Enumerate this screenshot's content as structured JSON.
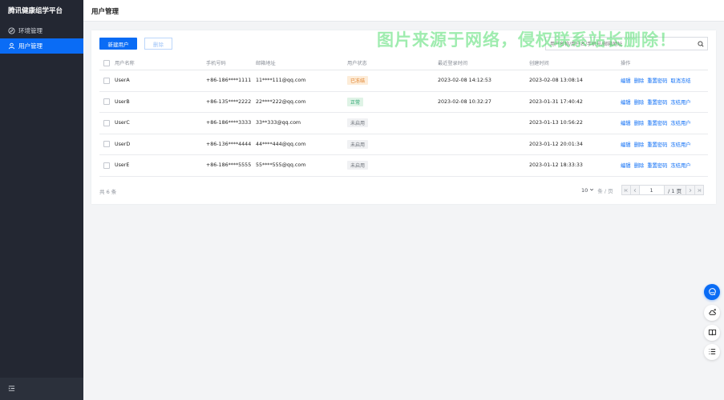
{
  "app": {
    "title": "腾讯健康组学平台"
  },
  "sidebar": {
    "items": [
      {
        "label": "环境管理",
        "icon": "compass-icon",
        "active": false
      },
      {
        "label": "用户管理",
        "icon": "user-icon",
        "active": true
      }
    ],
    "footer_icon": "menu-fold-icon"
  },
  "header": {
    "title": "用户管理"
  },
  "toolbar": {
    "create_label": "新建用户",
    "delete_label": "删除"
  },
  "search": {
    "placeholder": "用户名称/用户名/手机号/邮箱地址"
  },
  "watermark": "图片来源于网络，侵权联系站长删除！",
  "table": {
    "columns": {
      "name": "用户名称",
      "phone": "手机号码",
      "email": "邮箱地址",
      "status": "用户状态",
      "last_login": "最近登录时间",
      "created": "创建时间",
      "actions": "操作"
    },
    "rows": [
      {
        "name": "UserA",
        "phone": "+86-186****1111",
        "email": "11****111@qq.com",
        "status": "已冻结",
        "status_type": "frozen",
        "last_login": "2023-02-08 14:12:53",
        "created": "2023-02-08 13:08:14",
        "actions": [
          "编辑",
          "删除",
          "重置密码",
          "取消冻结"
        ]
      },
      {
        "name": "UserB",
        "phone": "+86-135****2222",
        "email": "22****222@qq.com",
        "status": "正常",
        "status_type": "normal",
        "last_login": "2023-02-08 10:32:27",
        "created": "2023-01-31 17:40:42",
        "actions": [
          "编辑",
          "删除",
          "重置密码",
          "冻结用户"
        ]
      },
      {
        "name": "UserC",
        "phone": "+86-186****3333",
        "email": "33**333@qq.com",
        "status": "未启用",
        "status_type": "inactive",
        "last_login": "",
        "created": "2023-01-13 10:56:22",
        "actions": [
          "编辑",
          "删除",
          "重置密码",
          "冻结用户"
        ]
      },
      {
        "name": "UserD",
        "phone": "+86-136****4444",
        "email": "44****444@qq.com",
        "status": "未启用",
        "status_type": "inactive",
        "last_login": "",
        "created": "2023-01-12 20:01:34",
        "actions": [
          "编辑",
          "删除",
          "重置密码",
          "冻结用户"
        ]
      },
      {
        "name": "UserE",
        "phone": "+86-186****5555",
        "email": "55****555@qq.com",
        "status": "未启用",
        "status_type": "inactive",
        "last_login": "",
        "created": "2023-01-12 18:33:33",
        "actions": [
          "编辑",
          "删除",
          "重置密码",
          "冻结用户"
        ]
      }
    ]
  },
  "pagination": {
    "total_text": "共 6 条",
    "page_size": "10",
    "page_size_unit": "条 / 页",
    "current_page": "1",
    "total_pages": "/ 1 页"
  },
  "colors": {
    "primary": "#0a6cf5",
    "sidebar": "#232732"
  },
  "float_icons": [
    "headset-icon",
    "cloud-icon",
    "book-icon",
    "list-icon"
  ]
}
